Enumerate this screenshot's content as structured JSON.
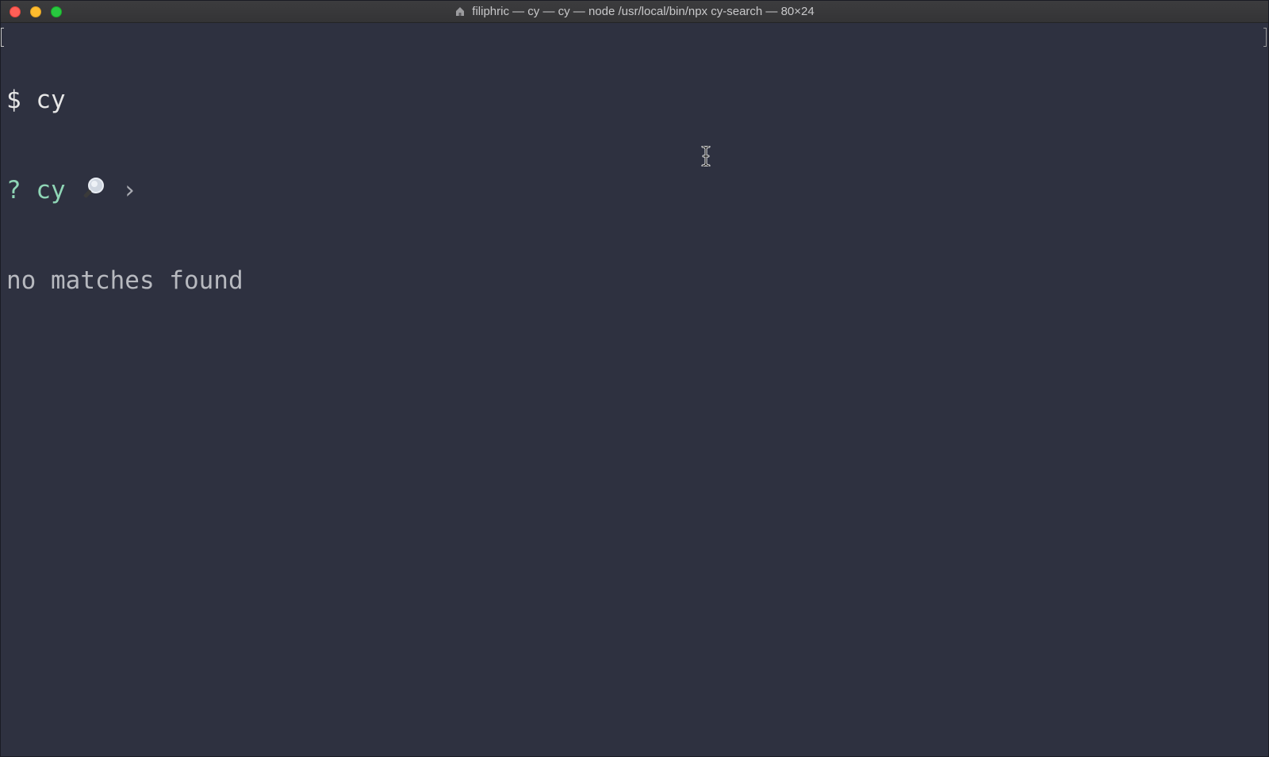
{
  "window": {
    "title": "filiphric — cy — cy — node /usr/local/bin/npx cy-search — 80×24",
    "icons": {
      "close": "close-button",
      "minimize": "minimize-button",
      "maximize": "maximize-button",
      "title_icon": "home-folder-icon"
    }
  },
  "terminal": {
    "line1": {
      "prompt": "$",
      "command": "cy"
    },
    "line2": {
      "prompt": "?",
      "query": "cy",
      "search_icon": "magnifier-icon",
      "chevron": "›"
    },
    "line3": {
      "message": "no matches found"
    }
  },
  "colors": {
    "background": "#2e3140",
    "prompt_green": "#8fd6b6",
    "text": "#e6e6e6",
    "muted": "#b7b9bf"
  }
}
